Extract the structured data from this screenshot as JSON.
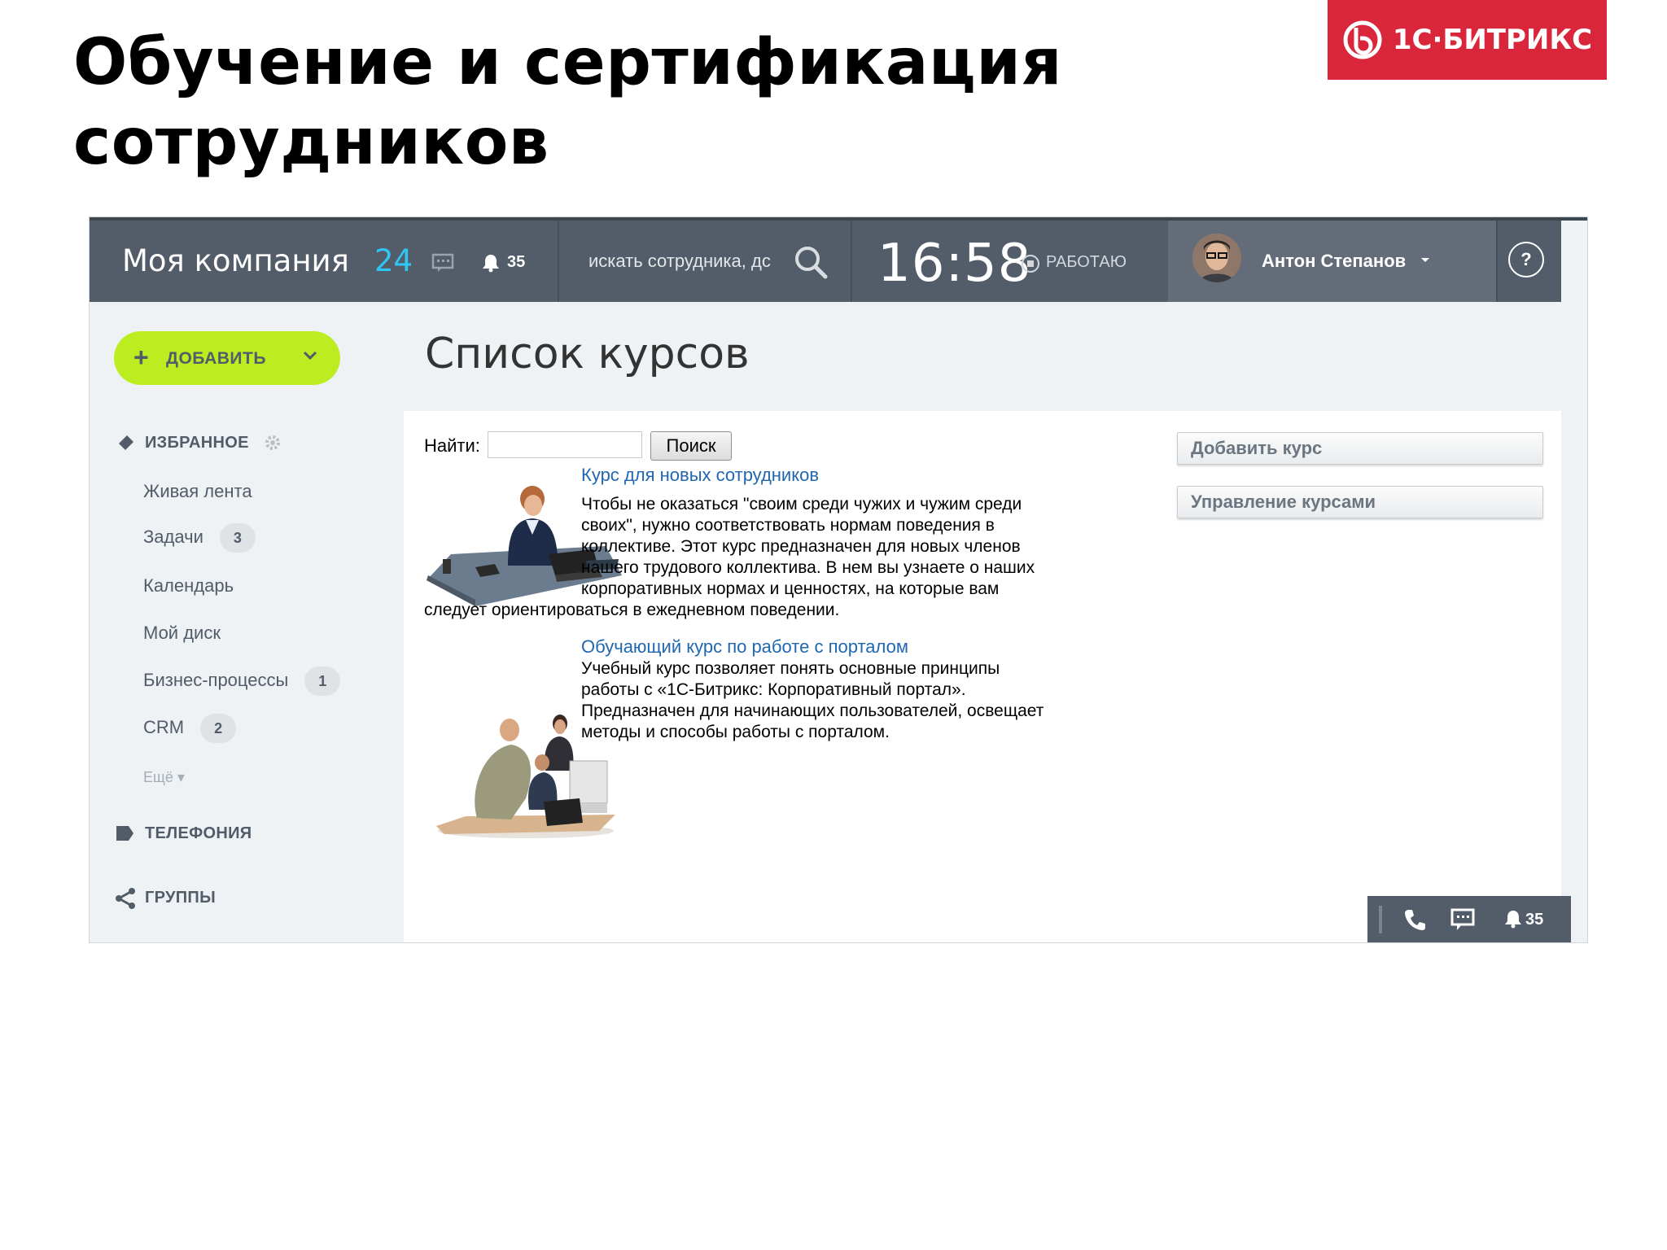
{
  "slide": {
    "title_line1": "Обучение и сертификация",
    "title_line2": "сотрудников",
    "logo_text": "1С·БИТРИКС"
  },
  "topbar": {
    "company": "Моя компания",
    "company_num": "24",
    "notifications": "35",
    "search_placeholder": "искать сотрудника, дс",
    "clock": "16:58",
    "status": "РАБОТАЮ",
    "user_name": "Антон Степанов",
    "help": "?"
  },
  "sidebar": {
    "add_button": "ДОБАВИТЬ",
    "favorites": "ИЗБРАННОЕ",
    "items": [
      {
        "label": "Живая лента",
        "count": ""
      },
      {
        "label": "Задачи",
        "count": "3"
      },
      {
        "label": "Календарь",
        "count": ""
      },
      {
        "label": "Мой диск",
        "count": ""
      },
      {
        "label": "Бизнес-процессы",
        "count": "1"
      },
      {
        "label": "CRM",
        "count": "2"
      }
    ],
    "more": "Ещё",
    "telephony": "ТЕЛЕФОНИЯ",
    "groups": "ГРУППЫ"
  },
  "main": {
    "page_title": "Список курсов",
    "find_label": "Найти:",
    "find_value": "",
    "find_button": "Поиск",
    "courses": [
      {
        "title": "Курс для новых сотрудников",
        "desc_lines": [
          "Чтобы не оказаться \"своим среди чужих и чужим среди",
          "своих\", нужно соответствовать нормам поведения в",
          "коллективе. Этот курс предназначен для новых членов",
          "нашего трудового коллектива. В нем вы узнаете о наших",
          "корпоративных нормах и ценностях, на которые вам"
        ],
        "desc_last": "следует ориентироваться в ежедневном поведении."
      },
      {
        "title": "Обучающий курс по работе с порталом",
        "desc_lines": [
          "Учебный курс позволяет понять основные принципы",
          "работы с «1С-Битрикс: Корпоративный портал».",
          "Предназначен для начинающих пользователей, освещает",
          "методы и способы работы с порталом."
        ]
      }
    ],
    "side_buttons": [
      "Добавить курс",
      "Управление курсами"
    ]
  },
  "bottom_bar": {
    "notifications": "35"
  },
  "colors": {
    "topbar": "#535c69",
    "accent_blue": "#2fc6f6",
    "add_green": "#bbed21",
    "logo_red": "#d9263a",
    "link": "#2067b0"
  },
  "icons": [
    "bitrix-logo-icon",
    "chat-icon",
    "bell-icon",
    "search-icon",
    "status-icon",
    "caret-icon",
    "help-icon",
    "pin-icon",
    "gear-icon",
    "telephony-icon",
    "share-icon",
    "phone-icon"
  ]
}
